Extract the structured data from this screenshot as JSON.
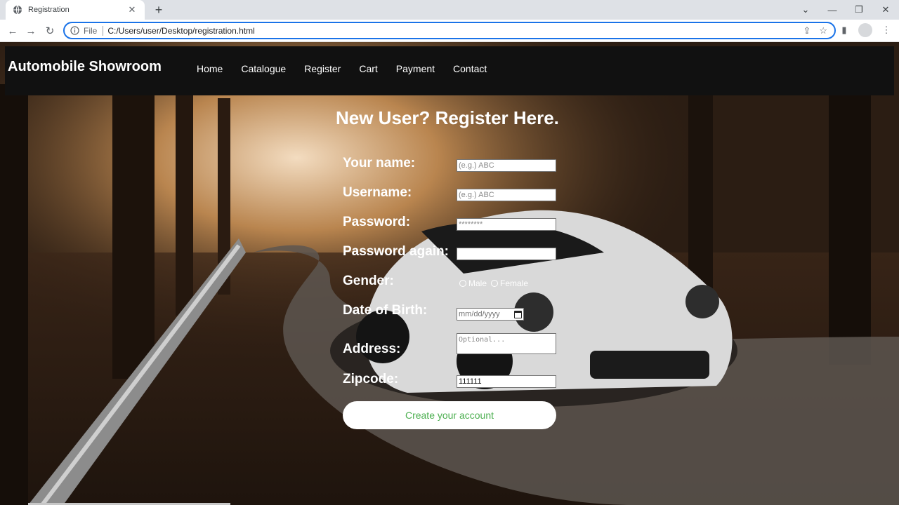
{
  "browser": {
    "tab_title": "Registration",
    "new_tab": "+",
    "scheme": "File",
    "url": "C:/Users/user/Desktop/registration.html"
  },
  "page": {
    "brand": "Automobile Showroom",
    "nav": [
      "Home",
      "Catalogue",
      "Register",
      "Cart",
      "Payment",
      "Contact"
    ],
    "form_title": "New User? Register Here.",
    "fields": {
      "name": {
        "label": "Your name:",
        "placeholder": "(e.g.) ABC"
      },
      "username": {
        "label": "Username:",
        "placeholder": "(e.g.) ABC"
      },
      "password": {
        "label": "Password:",
        "placeholder": "********"
      },
      "password_again": {
        "label": "Password again:",
        "placeholder": ""
      },
      "gender": {
        "label": "Gender:",
        "options": [
          "Male",
          "Female"
        ]
      },
      "dob": {
        "label": "Date of Birth:",
        "placeholder": "mm/dd/yyyy"
      },
      "address": {
        "label": "Address:",
        "placeholder": "Optional..."
      },
      "zipcode": {
        "label": "Zipcode:",
        "value": "111111"
      }
    },
    "submit_label": "Create your account"
  },
  "colors": {
    "accent": "#1a73e8",
    "navbar": "#111111",
    "submit_text": "#4caf50"
  }
}
